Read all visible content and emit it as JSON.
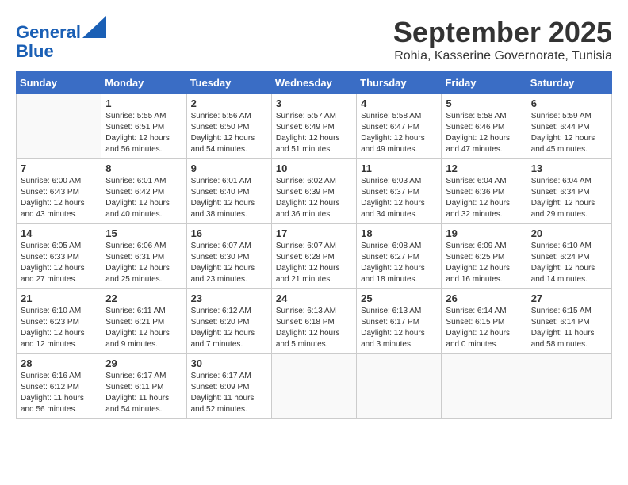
{
  "header": {
    "logo_line1": "General",
    "logo_line2": "Blue",
    "month": "September 2025",
    "location": "Rohia, Kasserine Governorate, Tunisia"
  },
  "weekdays": [
    "Sunday",
    "Monday",
    "Tuesday",
    "Wednesday",
    "Thursday",
    "Friday",
    "Saturday"
  ],
  "weeks": [
    [
      {
        "day": "",
        "info": ""
      },
      {
        "day": "1",
        "info": "Sunrise: 5:55 AM\nSunset: 6:51 PM\nDaylight: 12 hours\nand 56 minutes."
      },
      {
        "day": "2",
        "info": "Sunrise: 5:56 AM\nSunset: 6:50 PM\nDaylight: 12 hours\nand 54 minutes."
      },
      {
        "day": "3",
        "info": "Sunrise: 5:57 AM\nSunset: 6:49 PM\nDaylight: 12 hours\nand 51 minutes."
      },
      {
        "day": "4",
        "info": "Sunrise: 5:58 AM\nSunset: 6:47 PM\nDaylight: 12 hours\nand 49 minutes."
      },
      {
        "day": "5",
        "info": "Sunrise: 5:58 AM\nSunset: 6:46 PM\nDaylight: 12 hours\nand 47 minutes."
      },
      {
        "day": "6",
        "info": "Sunrise: 5:59 AM\nSunset: 6:44 PM\nDaylight: 12 hours\nand 45 minutes."
      }
    ],
    [
      {
        "day": "7",
        "info": "Sunrise: 6:00 AM\nSunset: 6:43 PM\nDaylight: 12 hours\nand 43 minutes."
      },
      {
        "day": "8",
        "info": "Sunrise: 6:01 AM\nSunset: 6:42 PM\nDaylight: 12 hours\nand 40 minutes."
      },
      {
        "day": "9",
        "info": "Sunrise: 6:01 AM\nSunset: 6:40 PM\nDaylight: 12 hours\nand 38 minutes."
      },
      {
        "day": "10",
        "info": "Sunrise: 6:02 AM\nSunset: 6:39 PM\nDaylight: 12 hours\nand 36 minutes."
      },
      {
        "day": "11",
        "info": "Sunrise: 6:03 AM\nSunset: 6:37 PM\nDaylight: 12 hours\nand 34 minutes."
      },
      {
        "day": "12",
        "info": "Sunrise: 6:04 AM\nSunset: 6:36 PM\nDaylight: 12 hours\nand 32 minutes."
      },
      {
        "day": "13",
        "info": "Sunrise: 6:04 AM\nSunset: 6:34 PM\nDaylight: 12 hours\nand 29 minutes."
      }
    ],
    [
      {
        "day": "14",
        "info": "Sunrise: 6:05 AM\nSunset: 6:33 PM\nDaylight: 12 hours\nand 27 minutes."
      },
      {
        "day": "15",
        "info": "Sunrise: 6:06 AM\nSunset: 6:31 PM\nDaylight: 12 hours\nand 25 minutes."
      },
      {
        "day": "16",
        "info": "Sunrise: 6:07 AM\nSunset: 6:30 PM\nDaylight: 12 hours\nand 23 minutes."
      },
      {
        "day": "17",
        "info": "Sunrise: 6:07 AM\nSunset: 6:28 PM\nDaylight: 12 hours\nand 21 minutes."
      },
      {
        "day": "18",
        "info": "Sunrise: 6:08 AM\nSunset: 6:27 PM\nDaylight: 12 hours\nand 18 minutes."
      },
      {
        "day": "19",
        "info": "Sunrise: 6:09 AM\nSunset: 6:25 PM\nDaylight: 12 hours\nand 16 minutes."
      },
      {
        "day": "20",
        "info": "Sunrise: 6:10 AM\nSunset: 6:24 PM\nDaylight: 12 hours\nand 14 minutes."
      }
    ],
    [
      {
        "day": "21",
        "info": "Sunrise: 6:10 AM\nSunset: 6:23 PM\nDaylight: 12 hours\nand 12 minutes."
      },
      {
        "day": "22",
        "info": "Sunrise: 6:11 AM\nSunset: 6:21 PM\nDaylight: 12 hours\nand 9 minutes."
      },
      {
        "day": "23",
        "info": "Sunrise: 6:12 AM\nSunset: 6:20 PM\nDaylight: 12 hours\nand 7 minutes."
      },
      {
        "day": "24",
        "info": "Sunrise: 6:13 AM\nSunset: 6:18 PM\nDaylight: 12 hours\nand 5 minutes."
      },
      {
        "day": "25",
        "info": "Sunrise: 6:13 AM\nSunset: 6:17 PM\nDaylight: 12 hours\nand 3 minutes."
      },
      {
        "day": "26",
        "info": "Sunrise: 6:14 AM\nSunset: 6:15 PM\nDaylight: 12 hours\nand 0 minutes."
      },
      {
        "day": "27",
        "info": "Sunrise: 6:15 AM\nSunset: 6:14 PM\nDaylight: 11 hours\nand 58 minutes."
      }
    ],
    [
      {
        "day": "28",
        "info": "Sunrise: 6:16 AM\nSunset: 6:12 PM\nDaylight: 11 hours\nand 56 minutes."
      },
      {
        "day": "29",
        "info": "Sunrise: 6:17 AM\nSunset: 6:11 PM\nDaylight: 11 hours\nand 54 minutes."
      },
      {
        "day": "30",
        "info": "Sunrise: 6:17 AM\nSunset: 6:09 PM\nDaylight: 11 hours\nand 52 minutes."
      },
      {
        "day": "",
        "info": ""
      },
      {
        "day": "",
        "info": ""
      },
      {
        "day": "",
        "info": ""
      },
      {
        "day": "",
        "info": ""
      }
    ]
  ]
}
